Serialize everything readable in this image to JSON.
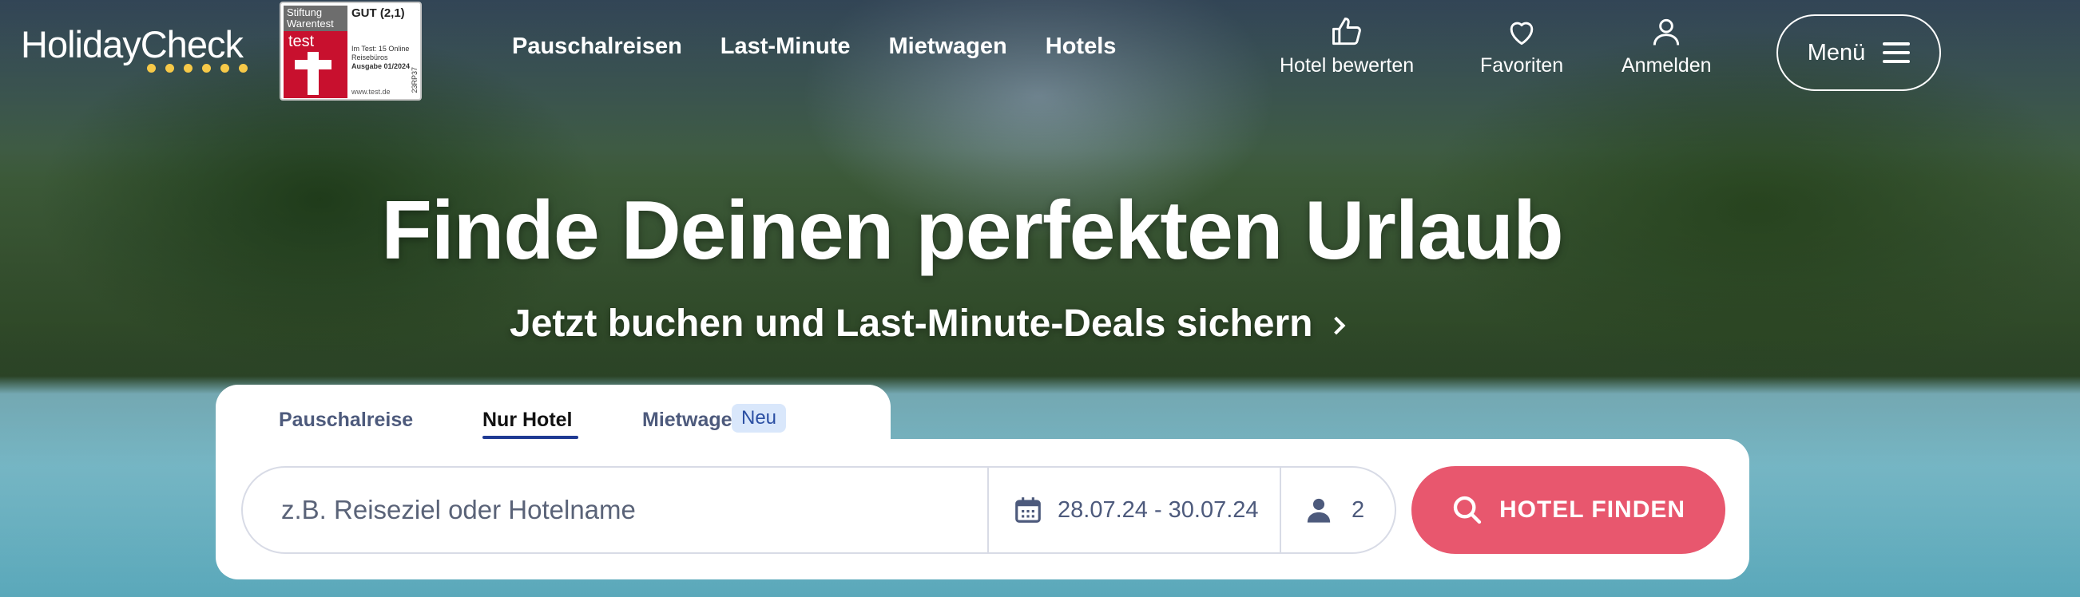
{
  "brand": {
    "logo_text": "HolidayCheck"
  },
  "badge": {
    "org": "Stiftung Warentest",
    "mark": "test",
    "grade": "GUT (2,1)",
    "detail": "Im Test: 15 Online Reisebüros",
    "issue": "Ausgabe 01/2024",
    "site": "www.test.de",
    "code": "23RP37"
  },
  "nav": {
    "items": [
      "Pauschalreisen",
      "Last-Minute",
      "Mietwagen",
      "Hotels"
    ]
  },
  "actions": {
    "rate_hotel": "Hotel bewerten",
    "favorites": "Favoriten",
    "login": "Anmelden",
    "menu": "Menü"
  },
  "hero": {
    "headline": "Finde Deinen perfekten Urlaub",
    "subline": "Jetzt buchen und Last-Minute-Deals sichern"
  },
  "search": {
    "tabs": [
      {
        "label": "Pauschalreise",
        "active": false
      },
      {
        "label": "Nur Hotel",
        "active": true
      },
      {
        "label": "Mietwagen",
        "active": false,
        "badge": "Neu"
      }
    ],
    "destination_placeholder": "z.B. Reiseziel oder Hotelname",
    "dates": "28.07.24 - 30.07.24",
    "travellers": "2",
    "submit_label": "HOTEL FINDEN"
  },
  "colors": {
    "accent_button": "#e8576e",
    "tab_underline": "#1f3a93",
    "logo_dots": "#f7c948"
  }
}
